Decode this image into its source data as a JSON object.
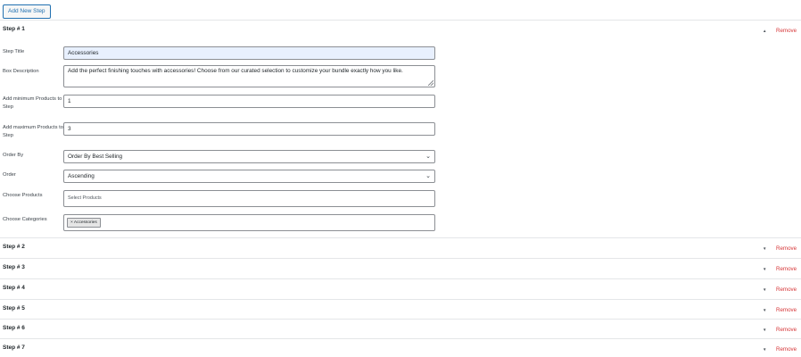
{
  "toolbar": {
    "add_label": "Add New Step"
  },
  "step1": {
    "title": "Step # 1",
    "chevron": "▲",
    "remove": "Remove",
    "fields": {
      "step_title_label": "Step Title",
      "step_title_value": "Accessories",
      "box_desc_label": "Box Description",
      "box_desc_value": "Add the perfect finishing touches with accessories! Choose from our curated selection to customize your bundle exactly how you like.",
      "min_label": "Add minimum Products to Step",
      "min_value": "1",
      "max_label": "Add maximum Products to Step",
      "max_value": "3",
      "order_by_label": "Order By",
      "order_by_value": "Order By Best Selling",
      "order_label": "Order",
      "order_value": "Ascending",
      "products_label": "Choose Products",
      "products_placeholder": "Select Products",
      "categories_label": "Choose Categories",
      "category_tag": "× Accessories"
    }
  },
  "collapsed_steps": [
    {
      "title": "Step # 2",
      "chevron": "▼",
      "remove": "Remove"
    },
    {
      "title": "Step # 3",
      "chevron": "▼",
      "remove": "Remove"
    },
    {
      "title": "Step # 4",
      "chevron": "▼",
      "remove": "Remove"
    },
    {
      "title": "Step # 5",
      "chevron": "▼",
      "remove": "Remove"
    },
    {
      "title": "Step # 6",
      "chevron": "▼",
      "remove": "Remove"
    },
    {
      "title": "Step # 7",
      "chevron": "▼",
      "remove": "Remove"
    }
  ],
  "icons": {
    "select_chevron": "⌄",
    "expand": "chevron-up-icon",
    "collapse": "chevron-down-icon"
  },
  "colors": {
    "accent": "#2271b1",
    "remove": "#d63638",
    "highlight_input": "#e8f0fe"
  }
}
